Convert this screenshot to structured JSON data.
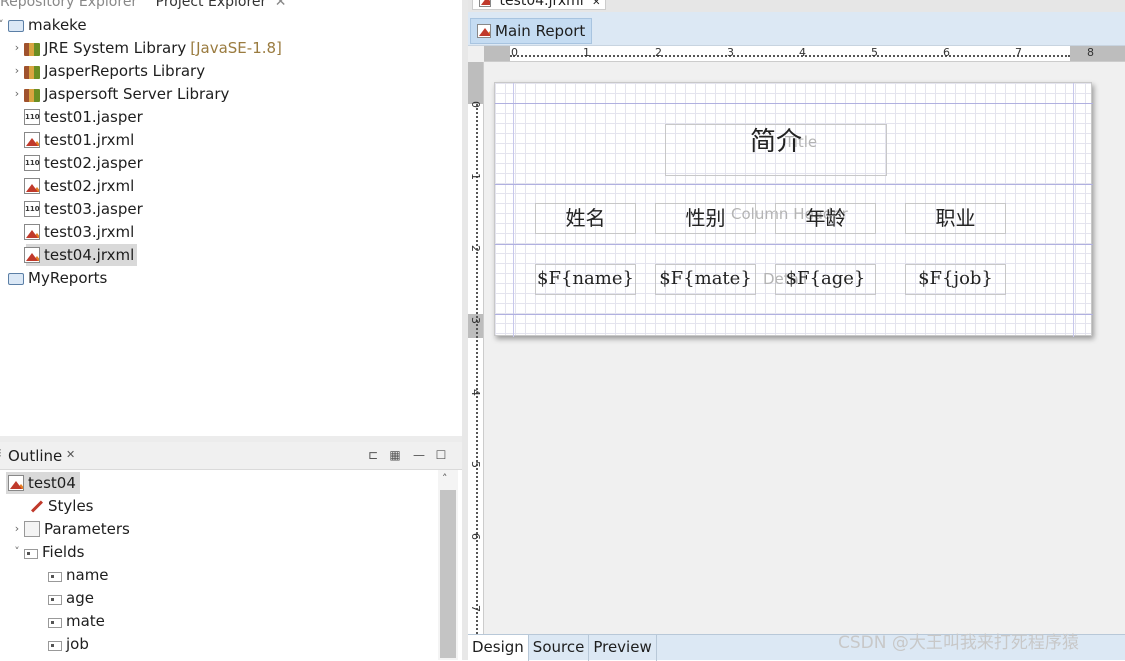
{
  "project_explorer": {
    "tabs_partial": [
      "Repository Explorer",
      "Project Explorer"
    ],
    "tree": [
      {
        "label": "makeke",
        "icon": "folder-icon"
      },
      {
        "label": "JRE System Library",
        "suffix": "[JavaSE-1.8]",
        "icon": "library-icon"
      },
      {
        "label": "JasperReports Library",
        "icon": "library-icon"
      },
      {
        "label": "Jaspersoft Server Library",
        "icon": "library-icon"
      },
      {
        "label": "test01.jasper",
        "icon": "jasper-file-icon"
      },
      {
        "label": "test01.jrxml",
        "icon": "jrxml-file-icon"
      },
      {
        "label": "test02.jasper",
        "icon": "jasper-file-icon"
      },
      {
        "label": "test02.jrxml",
        "icon": "jrxml-file-icon"
      },
      {
        "label": "test03.jasper",
        "icon": "jasper-file-icon"
      },
      {
        "label": "test03.jrxml",
        "icon": "jrxml-file-icon"
      },
      {
        "label": "test04.jrxml",
        "icon": "jrxml-file-icon",
        "selected": true
      },
      {
        "label": "MyReports",
        "icon": "folder-icon"
      }
    ]
  },
  "outline": {
    "title": "Outline",
    "tree": [
      {
        "label": "test04",
        "icon": "jrxml-file-icon"
      },
      {
        "label": "Styles",
        "icon": "styles-icon"
      },
      {
        "label": "Parameters",
        "icon": "parameters-icon"
      },
      {
        "label": "Fields",
        "icon": "fields-icon"
      },
      {
        "label": "name",
        "icon": "field-icon"
      },
      {
        "label": "age",
        "icon": "field-icon"
      },
      {
        "label": "mate",
        "icon": "field-icon"
      },
      {
        "label": "job",
        "icon": "field-icon"
      }
    ]
  },
  "editor": {
    "file_tab": "test04.jrxml",
    "sub_tab": "Main Report",
    "ruler_h": [
      "0",
      "1",
      "2",
      "3",
      "4",
      "5",
      "6",
      "7",
      "8"
    ],
    "ruler_v": [
      "0",
      "1",
      "2",
      "3",
      "4",
      "5",
      "6",
      "7"
    ],
    "report": {
      "title_text": "简介",
      "title_band_label": "Title",
      "column_header_label": "Column Header",
      "detail_label": "Detail",
      "headers": [
        "姓名",
        "性别",
        "年龄",
        "职业"
      ],
      "fields": [
        "$F{name}",
        "$F{mate}",
        "$F{age}",
        "$F{job}"
      ]
    },
    "bottom_tabs": [
      "Design",
      "Source",
      "Preview"
    ]
  },
  "watermark": "CSDN @大王叫我来打死程序猿",
  "colors": {
    "selection": "#d9d9d9",
    "editor_tab_bg": "#dce8f4",
    "band_line": "#b0b0e0"
  }
}
